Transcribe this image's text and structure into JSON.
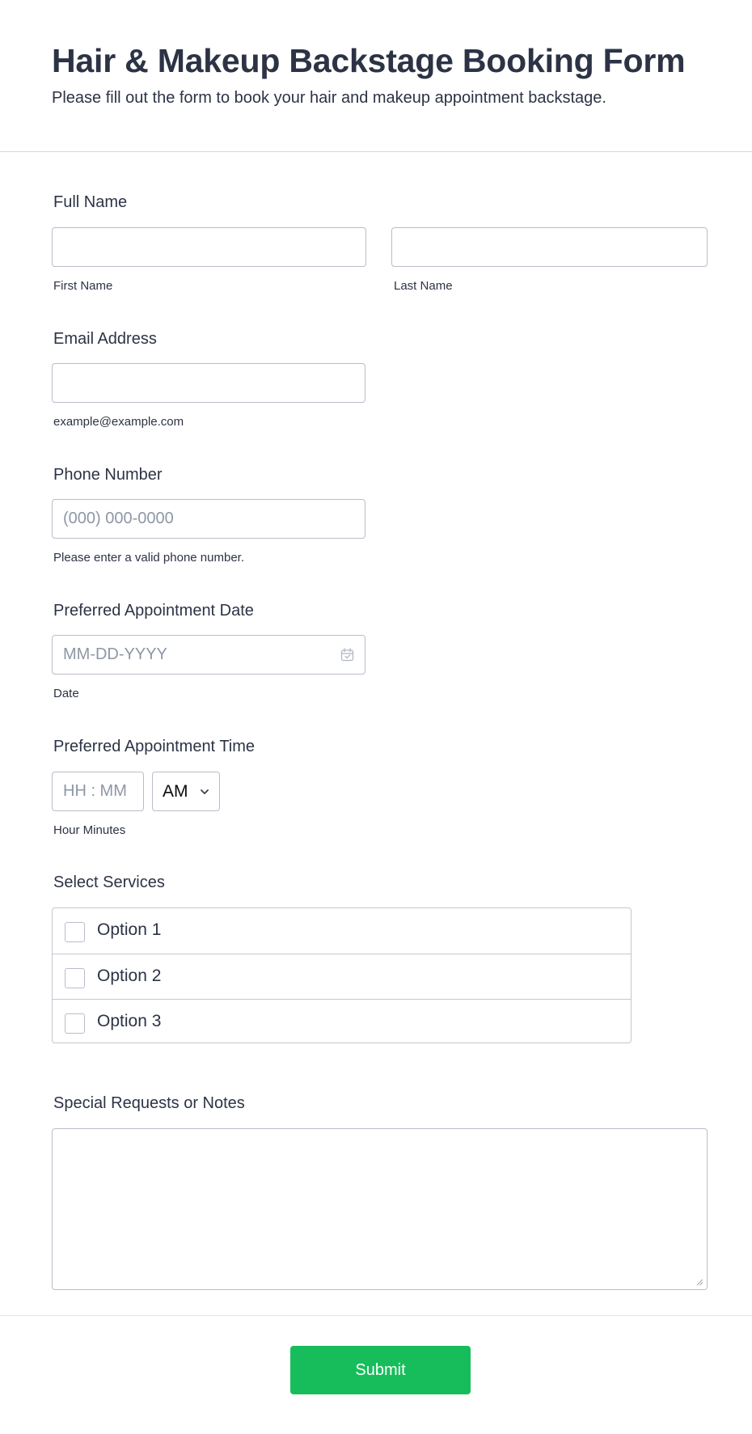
{
  "header": {
    "title": "Hair & Makeup Backstage Booking Form",
    "subtitle": "Please fill out the form to book your hair and makeup appointment backstage."
  },
  "full_name": {
    "label": "Full Name",
    "first_value": "",
    "last_value": "",
    "first_sublabel": "First Name",
    "last_sublabel": "Last Name"
  },
  "email": {
    "label": "Email Address",
    "value": "",
    "sublabel": "example@example.com"
  },
  "phone": {
    "label": "Phone Number",
    "placeholder": "(000) 000-0000",
    "sublabel": "Please enter a valid phone number."
  },
  "date": {
    "label": "Preferred Appointment Date",
    "placeholder": "MM-DD-YYYY",
    "sublabel": "Date",
    "icon": "calendar-icon"
  },
  "time": {
    "label": "Preferred Appointment Time",
    "placeholder": "HH : MM",
    "ampm_value": "AM",
    "sublabel": "Hour Minutes",
    "icon": "chevron-down-icon"
  },
  "services": {
    "label": "Select Services",
    "options": [
      {
        "label": "Option 1",
        "checked": false
      },
      {
        "label": "Option 2",
        "checked": false
      },
      {
        "label": "Option 3",
        "checked": false
      }
    ]
  },
  "notes": {
    "label": "Special Requests or Notes",
    "value": ""
  },
  "submit": {
    "label": "Submit",
    "color": "#18bd5b"
  },
  "colors": {
    "text": "#2c3345",
    "border": "#b8bdc9",
    "placeholder": "#8d97a5"
  }
}
